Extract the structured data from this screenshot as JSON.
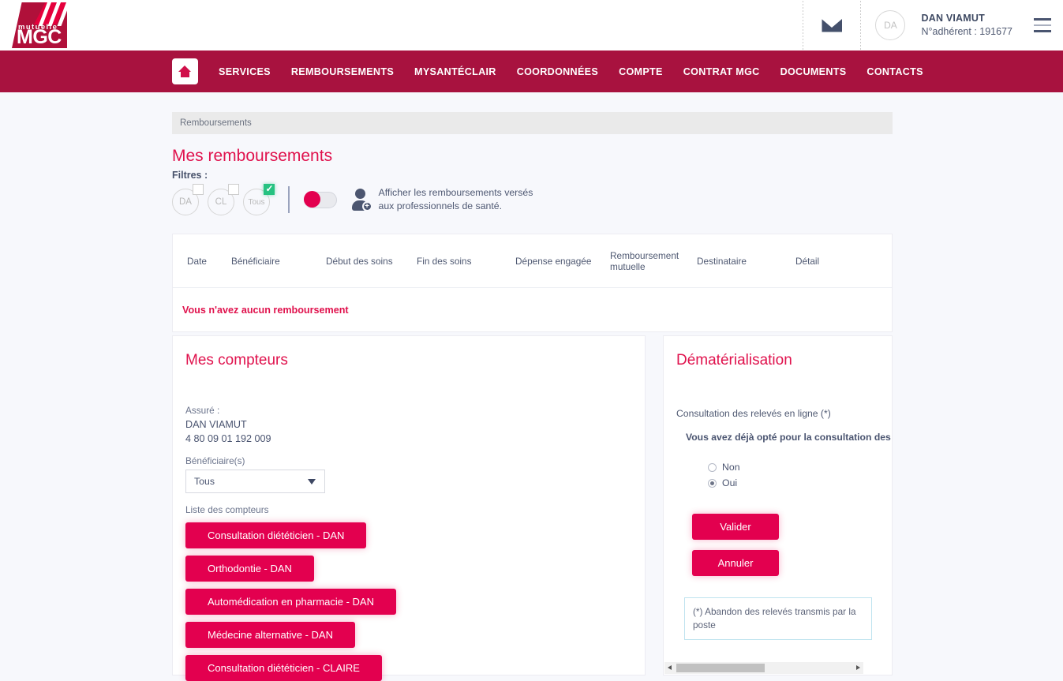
{
  "header": {
    "logo_top": "mutuelle",
    "logo_main": "MGC",
    "mail_icon": "envelope-icon",
    "avatar_initials": "DA",
    "user_name": "DAN VIAMUT",
    "member_number": "N°adhérent : 191677",
    "menu_icon": "hamburger-menu-icon"
  },
  "nav": {
    "home_icon": "home-icon",
    "items": [
      {
        "label": "SERVICES"
      },
      {
        "label": "REMBOURSEMENTS"
      },
      {
        "label": "MYSANTÉCLAIR"
      },
      {
        "label": "COORDONNÉES"
      },
      {
        "label": "COMPTE"
      },
      {
        "label": "CONTRAT MGC"
      },
      {
        "label": "DOCUMENTS"
      },
      {
        "label": "CONTACTS"
      }
    ]
  },
  "breadcrumb": "Remboursements",
  "page": {
    "title": "Mes remboursements",
    "filters_label": "Filtres :",
    "chips": [
      {
        "label": "DA",
        "checked": false
      },
      {
        "label": "CL",
        "checked": false
      },
      {
        "label": "Tous",
        "checked": true
      }
    ],
    "toggle_state": "off",
    "toggle_text_line1": "Afficher les remboursements versés",
    "toggle_text_line2": "aux professionnels de santé."
  },
  "table": {
    "columns": [
      "Date",
      "Bénéficiaire",
      "Début des soins",
      "Fin des soins",
      "Dépense engagée",
      "Remboursement mutuelle",
      "Destinataire",
      "Détail"
    ],
    "empty_message": "Vous n'avez aucun remboursement"
  },
  "counters": {
    "title": "Mes compteurs",
    "insured_label": "Assuré :",
    "insured_name": "DAN VIAMUT",
    "insured_number": "4 80 09 01 192 009",
    "beneficiary_label": "Bénéficiaire(s)",
    "beneficiary_value": "Tous",
    "list_label": "Liste des compteurs",
    "items": [
      {
        "label": "Consultation diététicien - DAN"
      },
      {
        "label": "Orthodontie - DAN"
      },
      {
        "label": "Automédication en pharmacie - DAN"
      },
      {
        "label": "Médecine alternative - DAN"
      },
      {
        "label": "Consultation diététicien - CLAIRE"
      }
    ]
  },
  "demat": {
    "title": "Dématérialisation",
    "question": "Consultation des relevés en ligne (*)",
    "note": "Vous avez déjà opté pour la consultation des relevés en ligne",
    "radio_no": "Non",
    "radio_yes": "Oui",
    "selected": "Oui",
    "validate_label": "Valider",
    "cancel_label": "Annuler",
    "footnote": "(*) Abandon des relevés transmis par la poste"
  },
  "colors": {
    "brand_crimson": "#e3004f",
    "nav_bar": "#a8123f",
    "page_bg": "#f7f8fc",
    "check_green": "#26c281"
  }
}
